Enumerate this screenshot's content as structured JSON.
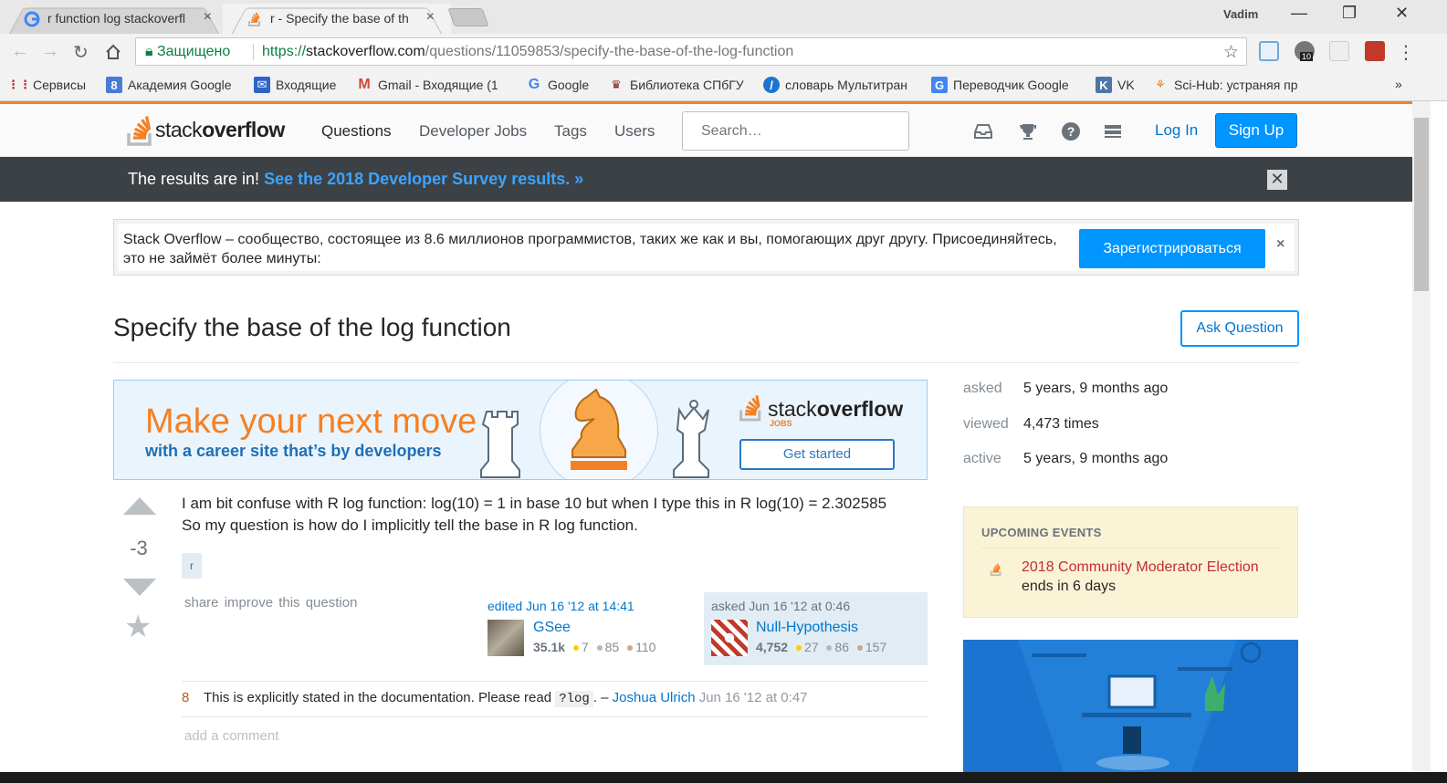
{
  "browser": {
    "tabs": [
      {
        "title": "r function log stackoverfl",
        "close": "×"
      },
      {
        "title": "r - Specify the base of th",
        "close": "×"
      }
    ],
    "profile": "Vadim",
    "window_buttons": [
      "—",
      "❐",
      "✕"
    ],
    "security_label": "Защищено",
    "url_scheme": "https://",
    "url_host": "stackoverflow.com",
    "url_path": "/questions/11059853/specify-the-base-of-the-log-function",
    "extension_badge": "10",
    "bookmarks": [
      {
        "label": "Сервисы",
        "icon": "apps-icon"
      },
      {
        "label": "Академия Google",
        "icon": "scholar-icon"
      },
      {
        "label": "Входящие",
        "icon": "inbox-icon"
      },
      {
        "label": "Gmail - Входящие (1",
        "icon": "gmail-icon"
      },
      {
        "label": "Google",
        "icon": "google-icon"
      },
      {
        "label": "Библиотека СПбГУ",
        "icon": "library-icon"
      },
      {
        "label": "словарь Мультитран",
        "icon": "multitran-icon"
      },
      {
        "label": "Переводчик Google",
        "icon": "translate-icon"
      },
      {
        "label": "VK",
        "icon": "vk-icon"
      },
      {
        "label": "Sci-Hub: устраняя пр",
        "icon": "scihub-icon"
      }
    ],
    "bookmarks_more": "»"
  },
  "so_header": {
    "logo_light": "stack",
    "logo_bold": "overflow",
    "nav": [
      "Questions",
      "Developer Jobs",
      "Tags",
      "Users"
    ],
    "search_placeholder": "Search…",
    "login": "Log In",
    "signup": "Sign Up"
  },
  "survey": {
    "text": "The results are in! ",
    "link": "See the 2018 Developer Survey results. »",
    "close": "✕"
  },
  "join": {
    "text": "Stack Overflow – сообщество, состоящее из 8.6 миллионов программистов, таких же как и вы, помогающих друг другу. Присоединяйтесь, это не займёт более минуты:",
    "button": "Зарегистрироваться",
    "close": "×"
  },
  "question": {
    "title": "Specify the base of the log function",
    "ask_button": "Ask Question",
    "votes": "-3",
    "body": "I am bit confuse with R log function: log(10) = 1 in base 10 but when I type this in R log(10) = 2.302585 So my question is how do I implicitly tell the base in R log function.",
    "tags": [
      "r"
    ],
    "links": "share  improve this question",
    "edited": "edited Jun 16 '12 at 14:41",
    "editor": {
      "name": "GSee",
      "rep": "35.1k",
      "gold": "7",
      "silver": "85",
      "bronze": "110"
    },
    "asked": "asked Jun 16 '12 at 0:46",
    "asker": {
      "name": "Null-Hypothesis",
      "rep": "4,752",
      "gold": "27",
      "silver": "86",
      "bronze": "157"
    }
  },
  "comment": {
    "score": "8",
    "text_before": "This is explicitly stated in the documentation. Please read ",
    "code": "?log",
    "text_after": ". – ",
    "user": "Joshua Ulrich",
    "time": " Jun 16 '12 at 0:47"
  },
  "add_comment": "add a comment",
  "ad": {
    "headline": "Make your next move",
    "subline": "with a career site that’s by developers",
    "logo_light": "stack",
    "logo_bold": "overflow",
    "jobs": "JOBS",
    "button": "Get started"
  },
  "sidebar": {
    "meta": [
      {
        "label": "asked",
        "value": "5 years, 9 months ago"
      },
      {
        "label": "viewed",
        "value": "4,473 times"
      },
      {
        "label": "active",
        "value": "5 years, 9 months ago"
      }
    ],
    "events_heading": "UPCOMING EVENTS",
    "event_title": "2018 Community Moderator Election",
    "event_sub": "ends in 6 days"
  },
  "colors": {
    "so_orange": "#f48024",
    "so_blue": "#0095ff",
    "link_blue": "#0077cc",
    "survey_bg": "#3c4146"
  }
}
